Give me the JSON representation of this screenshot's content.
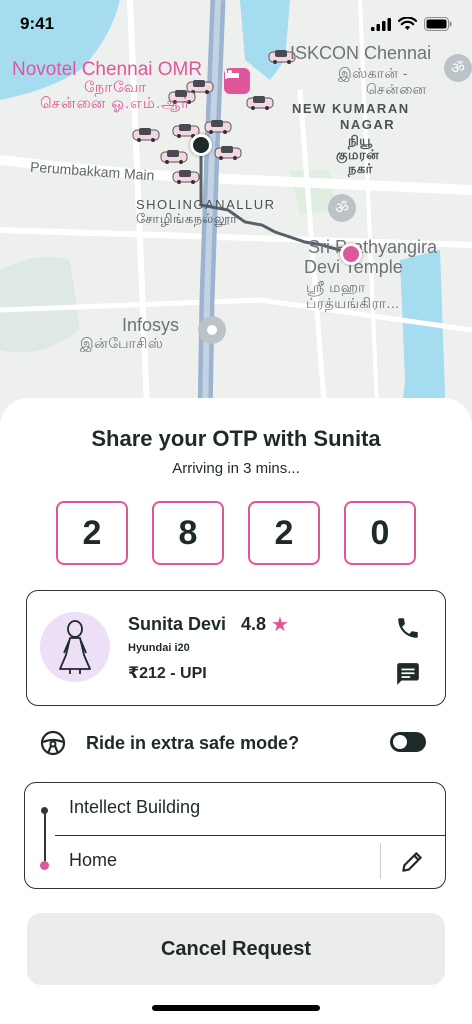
{
  "status_bar": {
    "time": "9:41"
  },
  "map": {
    "labels": {
      "novotel_line1": "Novotel Chennai OMR",
      "novotel_line2": "நோவோ",
      "novotel_line3": "சென்னை ஓ.எம்.ஆர்",
      "iskcon_line1": "ISKCON Chennai",
      "iskcon_line2": "இஸ்கான் -",
      "iskcon_line3": "சென்னை",
      "kumaran_line1": "NEW KUMARAN",
      "kumaran_line2": "NAGAR",
      "kumaran_line3": "நியூ",
      "kumaran_line4": "குமரன்",
      "kumaran_line5": "நகர்",
      "perumbakkam": "Perumbakkam Main",
      "sholinganallur_line1": "SHOLINGANALLUR",
      "sholinganallur_line2": "சோழிங்கநல்லூர்",
      "temple_line1": "Sri Prathyangira",
      "temple_line2": "Devi Temple",
      "temple_line3": "ஸ்ரீ மஹா",
      "temple_line4": "ப்ரத்யங்கிரா...",
      "infosys_line1": "Infosys",
      "infosys_line2": "இன்போசிஸ்"
    }
  },
  "sheet": {
    "title": "Share your OTP with Sunita",
    "subtitle": "Arriving in 3 mins...",
    "otp": [
      "2",
      "8",
      "2",
      "0"
    ],
    "driver": {
      "name": "Sunita Devi",
      "rating": "4.8",
      "vehicle": "Hyundai i20",
      "fare": "₹212 - UPI"
    },
    "safe_mode": {
      "label": "Ride in extra safe mode?",
      "enabled": false
    },
    "route": {
      "pickup": "Intellect Building",
      "drop": "Home"
    },
    "cancel_label": "Cancel Request"
  },
  "colors": {
    "accent": "#e0569a",
    "dark": "#1e2a2a",
    "button_bg": "#ececec",
    "map_bg": "#eef0ee",
    "water": "#a6dcef"
  }
}
